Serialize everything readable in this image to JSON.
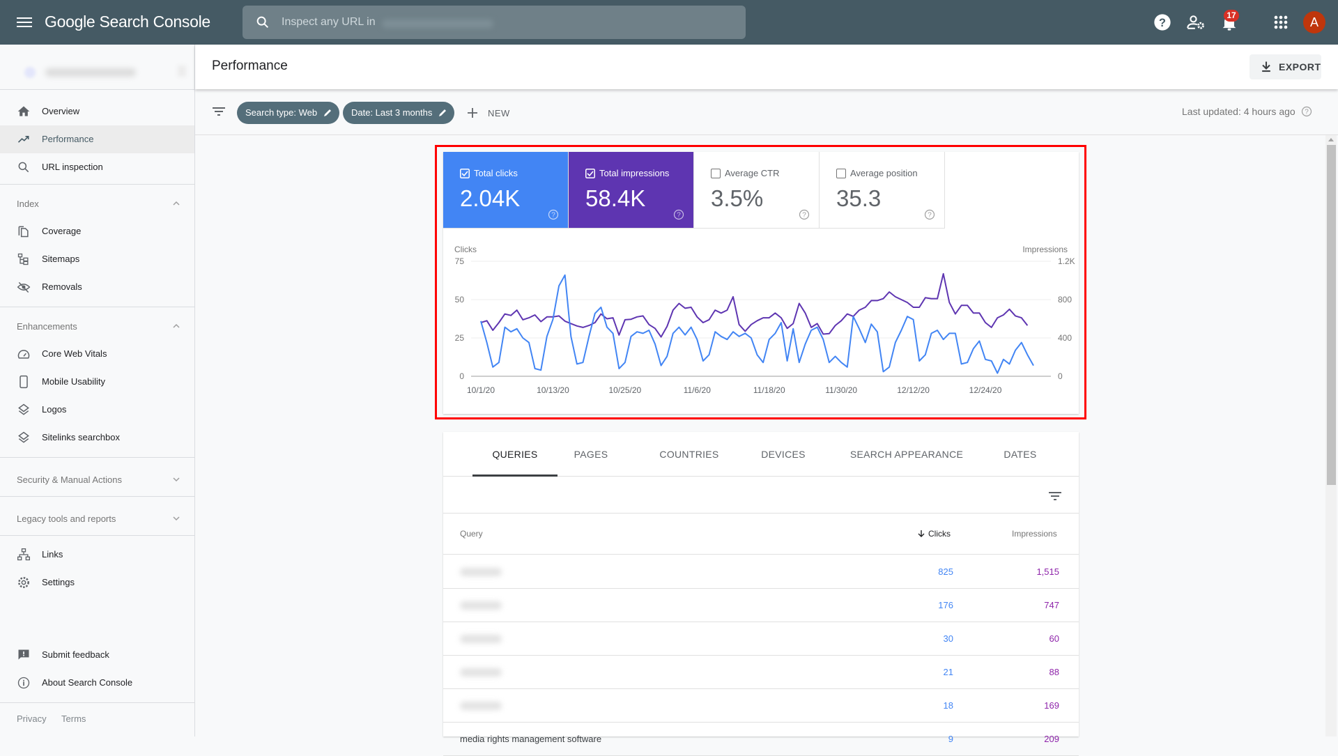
{
  "app": {
    "title": "Google Search Console",
    "search_placeholder": "Inspect any URL in",
    "notification_count": "17",
    "avatar_letter": "A"
  },
  "sidebar": {
    "items_top": [
      {
        "label": "Overview",
        "icon": "home-icon"
      },
      {
        "label": "Performance",
        "icon": "trending-up-icon",
        "active": true
      },
      {
        "label": "URL inspection",
        "icon": "search-icon"
      }
    ],
    "sections": [
      {
        "label": "Index",
        "expanded": true,
        "items": [
          {
            "label": "Coverage",
            "icon": "coverage-icon"
          },
          {
            "label": "Sitemaps",
            "icon": "sitemap-icon"
          },
          {
            "label": "Removals",
            "icon": "eye-off-icon"
          }
        ]
      },
      {
        "label": "Enhancements",
        "expanded": true,
        "items": [
          {
            "label": "Core Web Vitals",
            "icon": "speedometer-icon"
          },
          {
            "label": "Mobile Usability",
            "icon": "phone-icon"
          },
          {
            "label": "Logos",
            "icon": "layers-icon"
          },
          {
            "label": "Sitelinks searchbox",
            "icon": "layers-icon"
          }
        ]
      },
      {
        "label": "Security & Manual Actions",
        "expanded": false,
        "items": []
      },
      {
        "label": "Legacy tools and reports",
        "expanded": false,
        "items": []
      }
    ],
    "items_bottom": [
      {
        "label": "Links",
        "icon": "links-icon"
      },
      {
        "label": "Settings",
        "icon": "gear-icon"
      }
    ],
    "feedback": [
      {
        "label": "Submit feedback",
        "icon": "feedback-icon"
      },
      {
        "label": "About Search Console",
        "icon": "info-icon"
      }
    ],
    "footer": {
      "privacy": "Privacy",
      "terms": "Terms"
    }
  },
  "page": {
    "title": "Performance",
    "export_label": "EXPORT",
    "filters": [
      {
        "label": "Search type: Web"
      },
      {
        "label": "Date: Last 3 months"
      }
    ],
    "new_label": "NEW",
    "last_updated": "Last updated: 4 hours ago"
  },
  "metrics": [
    {
      "label": "Total clicks",
      "value": "2.04K",
      "checked": true,
      "color": "#4285f4"
    },
    {
      "label": "Total impressions",
      "value": "58.4K",
      "checked": true,
      "color": "#5e35b1"
    },
    {
      "label": "Average CTR",
      "value": "3.5%",
      "checked": false,
      "color": "#00897b"
    },
    {
      "label": "Average position",
      "value": "35.3",
      "checked": false,
      "color": "#e8710a"
    }
  ],
  "chart_data": {
    "type": "line",
    "title": "",
    "x_start": "10/1/20",
    "x_end": "12/30/20",
    "x_ticks": [
      "10/1/20",
      "10/13/20",
      "10/25/20",
      "11/6/20",
      "11/18/20",
      "11/30/20",
      "12/12/20",
      "12/24/20"
    ],
    "x_tick_indices": [
      0,
      12,
      24,
      36,
      48,
      60,
      72,
      84
    ],
    "left_axis": {
      "label": "Clicks",
      "ticks": [
        "0",
        "25",
        "50",
        "75"
      ],
      "range": [
        0,
        75
      ]
    },
    "right_axis": {
      "label": "Impressions",
      "ticks": [
        "0",
        "400",
        "800",
        "1.2K"
      ],
      "range": [
        0,
        1200
      ]
    },
    "grid": true,
    "legend": "none",
    "series": [
      {
        "name": "Clicks",
        "axis": "left",
        "color": "#4285f4",
        "values": [
          36,
          22,
          6,
          9,
          32,
          29,
          31,
          25,
          22,
          5,
          4,
          26,
          37,
          59,
          66,
          26,
          8,
          9,
          26,
          41,
          45,
          32,
          28,
          5,
          9,
          26,
          29,
          28,
          30,
          21,
          7,
          13,
          28,
          32,
          27,
          32,
          24,
          10,
          14,
          29,
          26,
          24,
          29,
          26,
          28,
          25,
          14,
          9,
          24,
          28,
          35,
          10,
          31,
          9,
          21,
          30,
          32,
          24,
          9,
          13,
          9,
          6,
          39,
          31,
          22,
          34,
          29,
          3,
          6,
          22,
          30,
          39,
          37,
          10,
          14,
          28,
          30,
          24,
          28,
          28,
          8,
          9,
          18,
          23,
          11,
          10,
          2,
          11,
          8,
          17,
          22,
          14,
          7
        ],
        "note": "approximate daily values read from chart"
      },
      {
        "name": "Impressions",
        "axis": "right",
        "color": "#5e35b1",
        "values": [
          560,
          580,
          480,
          560,
          650,
          635,
          690,
          590,
          610,
          640,
          570,
          620,
          620,
          630,
          575,
          550,
          525,
          510,
          530,
          560,
          650,
          600,
          610,
          430,
          590,
          595,
          620,
          630,
          540,
          500,
          410,
          520,
          690,
          760,
          710,
          720,
          620,
          560,
          590,
          690,
          660,
          690,
          830,
          540,
          470,
          540,
          580,
          610,
          610,
          660,
          610,
          500,
          550,
          760,
          660,
          510,
          550,
          440,
          445,
          530,
          580,
          650,
          625,
          690,
          720,
          790,
          790,
          810,
          880,
          830,
          800,
          770,
          720,
          720,
          820,
          810,
          810,
          1070,
          770,
          650,
          740,
          740,
          660,
          660,
          560,
          510,
          610,
          640,
          700,
          630,
          610,
          530
        ],
        "note": "approximate daily values read from chart"
      }
    ]
  },
  "table": {
    "tabs": [
      "QUERIES",
      "PAGES",
      "COUNTRIES",
      "DEVICES",
      "SEARCH APPEARANCE",
      "DATES"
    ],
    "active_tab": 0,
    "columns": {
      "query": "Query",
      "clicks": "Clicks",
      "impressions": "Impressions"
    },
    "sorted_by": "clicks",
    "rows": [
      {
        "query": "",
        "redacted": true,
        "clicks": "825",
        "impressions": "1,515"
      },
      {
        "query": "",
        "redacted": true,
        "clicks": "176",
        "impressions": "747"
      },
      {
        "query": "",
        "redacted": true,
        "clicks": "30",
        "impressions": "60"
      },
      {
        "query": "",
        "redacted": true,
        "clicks": "21",
        "impressions": "88"
      },
      {
        "query": "",
        "redacted": true,
        "clicks": "18",
        "impressions": "169"
      },
      {
        "query": "media rights management software",
        "redacted": false,
        "clicks": "9",
        "impressions": "209"
      }
    ]
  }
}
